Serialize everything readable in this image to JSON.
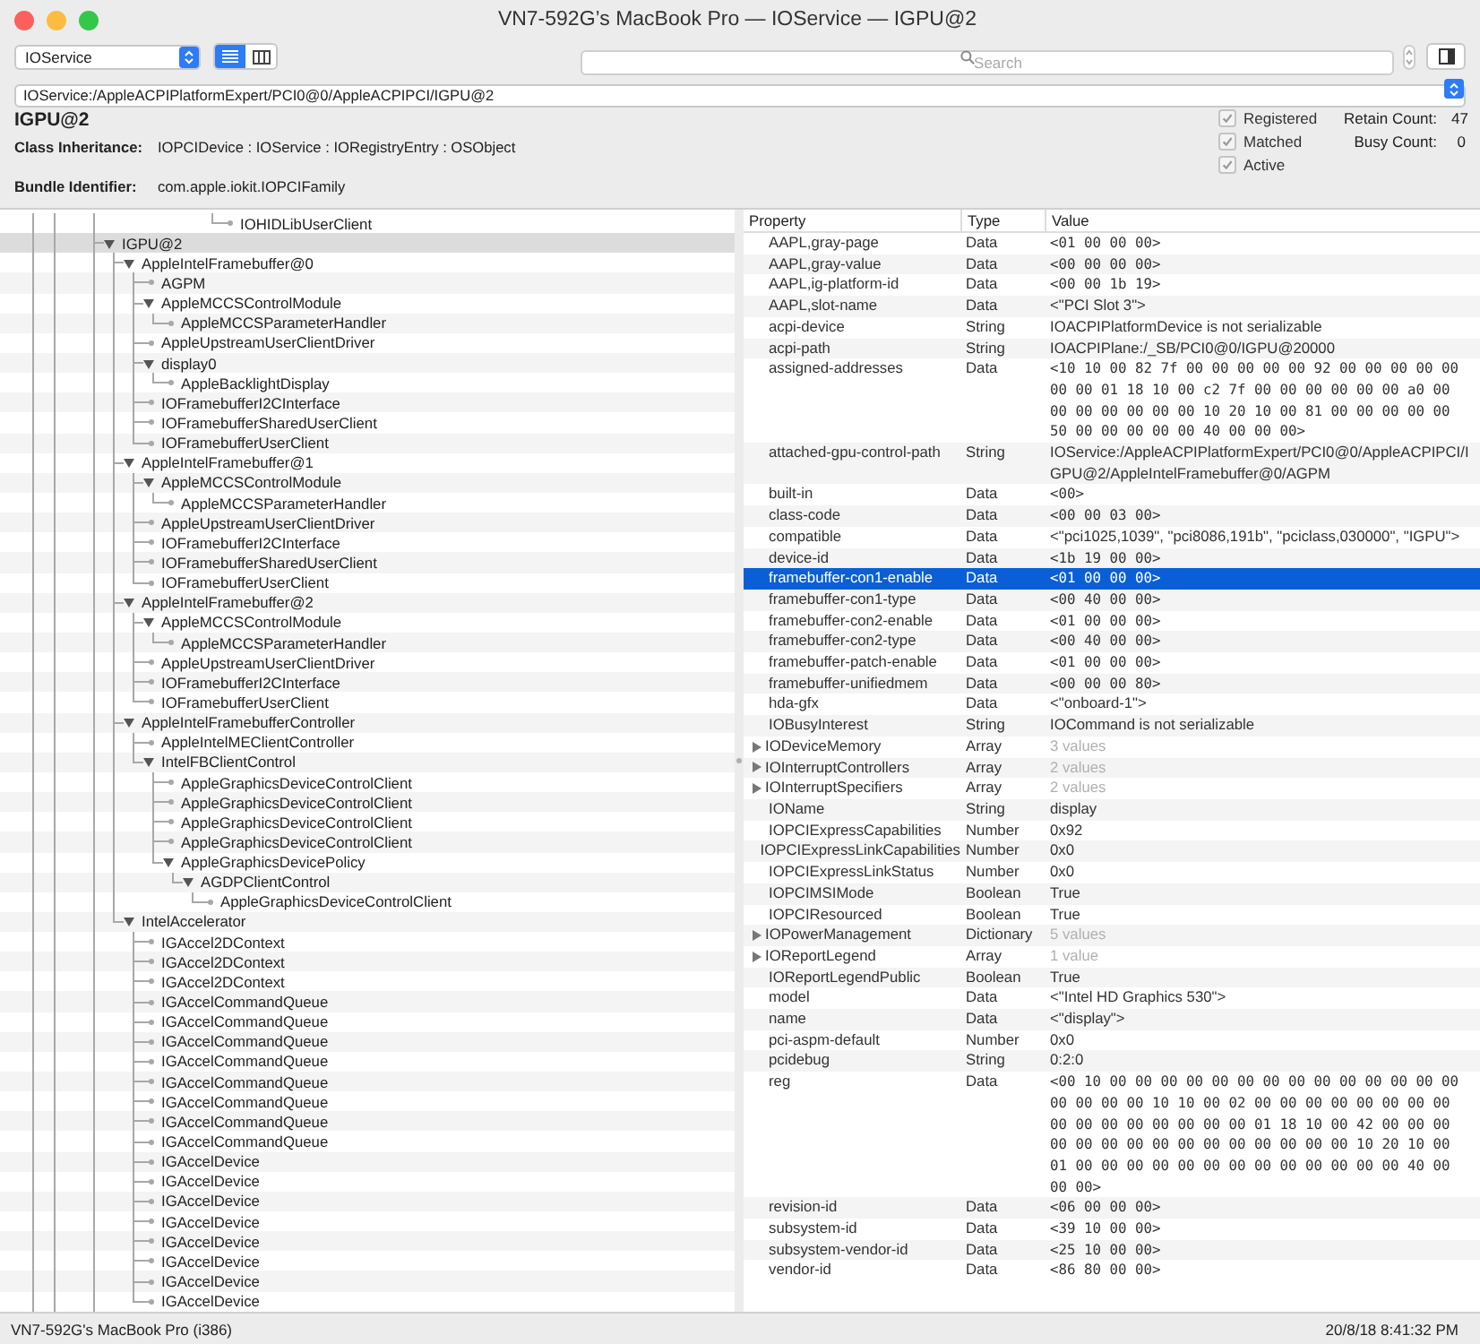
{
  "window": {
    "title": "VN7-592G’s MacBook Pro — IOService — IGPU@2"
  },
  "toolbar": {
    "plane": "IOService",
    "view_modes": [
      {
        "kind": "list",
        "selected": true
      },
      {
        "kind": "columns",
        "selected": false
      }
    ],
    "search": {
      "placeholder": "Search"
    }
  },
  "path": "IOService:/AppleACPIPlatformExpert/PCI0@0/AppleACPIPCI/IGPU@2",
  "info": {
    "name": "IGPU@2",
    "fields": [
      {
        "label": "Class Inheritance:",
        "value": "IOPCIDevice : IOService : IORegistryEntry : OSObject"
      },
      {
        "label": "Bundle Identifier:",
        "value": "com.apple.iokit.IOPCIFamily"
      }
    ],
    "flags": [
      {
        "label": "Registered",
        "checked": true
      },
      {
        "label": "Matched",
        "checked": true
      },
      {
        "label": "Active",
        "checked": true
      }
    ],
    "counts": [
      {
        "label": "Retain Count:",
        "value": "47"
      },
      {
        "label": "Busy Count:",
        "value": "0"
      }
    ]
  },
  "tree": {
    "trailing_row": "IOHIDLibUserClient",
    "nodes": [
      {
        "name": "IGPU@2",
        "selected": true,
        "expanded": true,
        "children": [
          {
            "name": "AppleIntelFramebuffer@0",
            "selected": false,
            "expanded": true,
            "children": [
              {
                "name": "AGPM",
                "selected": false
              },
              {
                "name": "AppleMCCSControlModule",
                "selected": false,
                "expanded": true,
                "children": [
                  {
                    "name": "AppleMCCSParameterHandler",
                    "selected": false
                  }
                ]
              },
              {
                "name": "AppleUpstreamUserClientDriver",
                "selected": false
              },
              {
                "name": "display0",
                "selected": false,
                "expanded": true,
                "children": [
                  {
                    "name": "AppleBacklightDisplay",
                    "selected": false
                  }
                ]
              },
              {
                "name": "IOFramebufferI2CInterface",
                "selected": false
              },
              {
                "name": "IOFramebufferSharedUserClient",
                "selected": false
              },
              {
                "name": "IOFramebufferUserClient",
                "selected": false
              }
            ]
          },
          {
            "name": "AppleIntelFramebuffer@1",
            "selected": false,
            "expanded": true,
            "children": [
              {
                "name": "AppleMCCSControlModule",
                "selected": false,
                "expanded": true,
                "children": [
                  {
                    "name": "AppleMCCSParameterHandler",
                    "selected": false
                  }
                ]
              },
              {
                "name": "AppleUpstreamUserClientDriver",
                "selected": false
              },
              {
                "name": "IOFramebufferI2CInterface",
                "selected": false
              },
              {
                "name": "IOFramebufferSharedUserClient",
                "selected": false
              },
              {
                "name": "IOFramebufferUserClient",
                "selected": false
              }
            ]
          },
          {
            "name": "AppleIntelFramebuffer@2",
            "selected": false,
            "expanded": true,
            "children": [
              {
                "name": "AppleMCCSControlModule",
                "selected": false,
                "expanded": true,
                "children": [
                  {
                    "name": "AppleMCCSParameterHandler",
                    "selected": false
                  }
                ]
              },
              {
                "name": "AppleUpstreamUserClientDriver",
                "selected": false
              },
              {
                "name": "IOFramebufferI2CInterface",
                "selected": false
              },
              {
                "name": "IOFramebufferUserClient",
                "selected": false
              }
            ]
          },
          {
            "name": "AppleIntelFramebufferController",
            "selected": false,
            "expanded": true,
            "children": [
              {
                "name": "AppleIntelMEClientController",
                "selected": false
              },
              {
                "name": "IntelFBClientControl",
                "selected": false,
                "expanded": true,
                "children": [
                  {
                    "name": "AppleGraphicsDeviceControlClient",
                    "selected": false
                  },
                  {
                    "name": "AppleGraphicsDeviceControlClient",
                    "selected": false
                  },
                  {
                    "name": "AppleGraphicsDeviceControlClient",
                    "selected": false
                  },
                  {
                    "name": "AppleGraphicsDeviceControlClient",
                    "selected": false
                  },
                  {
                    "name": "AppleGraphicsDevicePolicy",
                    "selected": false,
                    "expanded": true,
                    "children": [
                      {
                        "name": "AGDPClientControl",
                        "selected": false,
                        "expanded": true,
                        "children": [
                          {
                            "name": "AppleGraphicsDeviceControlClient",
                            "selected": false
                          }
                        ]
                      }
                    ]
                  }
                ]
              }
            ]
          },
          {
            "name": "IntelAccelerator",
            "selected": false,
            "expanded": true,
            "children": [
              {
                "name": "IGAccel2DContext",
                "selected": false
              },
              {
                "name": "IGAccel2DContext",
                "selected": false
              },
              {
                "name": "IGAccel2DContext",
                "selected": false
              },
              {
                "name": "IGAccelCommandQueue",
                "selected": false
              },
              {
                "name": "IGAccelCommandQueue",
                "selected": false
              },
              {
                "name": "IGAccelCommandQueue",
                "selected": false
              },
              {
                "name": "IGAccelCommandQueue",
                "selected": false
              },
              {
                "name": "IGAccelCommandQueue",
                "selected": false
              },
              {
                "name": "IGAccelCommandQueue",
                "selected": false
              },
              {
                "name": "IGAccelCommandQueue",
                "selected": false
              },
              {
                "name": "IGAccelCommandQueue",
                "selected": false
              },
              {
                "name": "IGAccelDevice",
                "selected": false
              },
              {
                "name": "IGAccelDevice",
                "selected": false
              },
              {
                "name": "IGAccelDevice",
                "selected": false
              },
              {
                "name": "IGAccelDevice",
                "selected": false
              },
              {
                "name": "IGAccelDevice",
                "selected": false
              },
              {
                "name": "IGAccelDevice",
                "selected": false
              },
              {
                "name": "IGAccelDevice",
                "selected": false
              },
              {
                "name": "IGAccelDevice",
                "selected": false
              }
            ]
          }
        ]
      }
    ]
  },
  "properties": {
    "columns": [
      "Property",
      "Type",
      "Value"
    ],
    "rows": [
      {
        "property": "AAPL,gray-page",
        "type": "Data",
        "value": "<01 00 00 00>",
        "kind": "hex",
        "selected": false
      },
      {
        "property": "AAPL,gray-value",
        "type": "Data",
        "value": "<00 00 00 00>",
        "kind": "hex",
        "selected": false
      },
      {
        "property": "AAPL,ig-platform-id",
        "type": "Data",
        "value": "<00 00 1b 19>",
        "kind": "hex",
        "selected": false
      },
      {
        "property": "AAPL,slot-name",
        "type": "Data",
        "value": "<\"PCI Slot 3\">",
        "kind": "text",
        "selected": false
      },
      {
        "property": "acpi-device",
        "type": "String",
        "value": "IOACPIPlatformDevice is not serializable",
        "kind": "text",
        "selected": false
      },
      {
        "property": "acpi-path",
        "type": "String",
        "value": "IOACPIPlane:/_SB/PCI0@0/IGPU@20000",
        "kind": "text",
        "selected": false
      },
      {
        "property": "assigned-addresses",
        "type": "Data",
        "value": "<10 10 00 82 7f 00 00 00 00 00 92 00 00 00 00 00 00 00 01 18 10 00 c2 7f 00 00 00 00 00 00 a0 00 00 00 00 00 00 00 10 20 10 00 81 00 00 00 00 00 50 00 00 00 00 00 40 00 00 00>",
        "kind": "hex",
        "selected": false
      },
      {
        "property": "attached-gpu-control-path",
        "type": "String",
        "value": "IOService:/AppleACPIPlatformExpert/PCI0@0/AppleACPIPCI/IGPU@2/AppleIntelFramebuffer@0/AGPM",
        "kind": "path",
        "selected": false
      },
      {
        "property": "built-in",
        "type": "Data",
        "value": "<00>",
        "kind": "hex",
        "selected": false
      },
      {
        "property": "class-code",
        "type": "Data",
        "value": "<00 00 03 00>",
        "kind": "hex",
        "selected": false
      },
      {
        "property": "compatible",
        "type": "Data",
        "value": "<\"pci1025,1039\", \"pci8086,191b\", \"pciclass,030000\", \"IGPU\">",
        "kind": "text",
        "selected": false
      },
      {
        "property": "device-id",
        "type": "Data",
        "value": "<1b 19 00 00>",
        "kind": "hex",
        "selected": false
      },
      {
        "property": "framebuffer-con1-enable",
        "type": "Data",
        "value": "<01 00 00 00>",
        "kind": "hex",
        "selected": true
      },
      {
        "property": "framebuffer-con1-type",
        "type": "Data",
        "value": "<00 40 00 00>",
        "kind": "hex",
        "selected": false
      },
      {
        "property": "framebuffer-con2-enable",
        "type": "Data",
        "value": "<01 00 00 00>",
        "kind": "hex",
        "selected": false
      },
      {
        "property": "framebuffer-con2-type",
        "type": "Data",
        "value": "<00 40 00 00>",
        "kind": "hex",
        "selected": false
      },
      {
        "property": "framebuffer-patch-enable",
        "type": "Data",
        "value": "<01 00 00 00>",
        "kind": "hex",
        "selected": false
      },
      {
        "property": "framebuffer-unifiedmem",
        "type": "Data",
        "value": "<00 00 00 80>",
        "kind": "hex",
        "selected": false
      },
      {
        "property": "hda-gfx",
        "type": "Data",
        "value": "<\"onboard-1\">",
        "kind": "text",
        "selected": false
      },
      {
        "property": "IOBusyInterest",
        "type": "String",
        "value": "IOCommand is not serializable",
        "kind": "text",
        "selected": false
      },
      {
        "property": "IODeviceMemory",
        "type": "Array",
        "value": "3 values",
        "kind": "count",
        "selected": false,
        "expanded": false
      },
      {
        "property": "IOInterruptControllers",
        "type": "Array",
        "value": "2 values",
        "kind": "count",
        "selected": false,
        "expanded": false
      },
      {
        "property": "IOInterruptSpecifiers",
        "type": "Array",
        "value": "2 values",
        "kind": "count",
        "selected": false,
        "expanded": false
      },
      {
        "property": "IOName",
        "type": "String",
        "value": "display",
        "kind": "text",
        "selected": false
      },
      {
        "property": "IOPCIExpressCapabilities",
        "type": "Number",
        "value": "0x92",
        "kind": "text",
        "selected": false
      },
      {
        "property": "IOPCIExpressLinkCapabilities",
        "type": "Number",
        "value": "0x0",
        "kind": "text",
        "selected": false
      },
      {
        "property": "IOPCIExpressLinkStatus",
        "type": "Number",
        "value": "0x0",
        "kind": "text",
        "selected": false
      },
      {
        "property": "IOPCIMSIMode",
        "type": "Boolean",
        "value": "True",
        "kind": "text",
        "selected": false
      },
      {
        "property": "IOPCIResourced",
        "type": "Boolean",
        "value": "True",
        "kind": "text",
        "selected": false
      },
      {
        "property": "IOPowerManagement",
        "type": "Dictionary",
        "value": "5 values",
        "kind": "count",
        "selected": false,
        "expanded": false
      },
      {
        "property": "IOReportLegend",
        "type": "Array",
        "value": "1 value",
        "kind": "count",
        "selected": false,
        "expanded": false
      },
      {
        "property": "IOReportLegendPublic",
        "type": "Boolean",
        "value": "True",
        "kind": "text",
        "selected": false
      },
      {
        "property": "model",
        "type": "Data",
        "value": "<\"Intel HD Graphics 530\">",
        "kind": "text",
        "selected": false
      },
      {
        "property": "name",
        "type": "Data",
        "value": "<\"display\">",
        "kind": "text",
        "selected": false
      },
      {
        "property": "pci-aspm-default",
        "type": "Number",
        "value": "0x0",
        "kind": "text",
        "selected": false
      },
      {
        "property": "pcidebug",
        "type": "String",
        "value": "0:2:0",
        "kind": "text",
        "selected": false
      },
      {
        "property": "reg",
        "type": "Data",
        "value": "<00 10 00 00 00 00 00 00 00 00 00 00 00 00 00 00 00 00 00 00 10 10 00 02 00 00 00 00 00 00 00 00 00 00 00 00 00 00 00 00 01 18 10 00 42 00 00 00 00 00 00 00 00 00 00 00 00 00 00 00 10 20 10 00 01 00 00 00 00 00 00 00 00 00 00 00 00 00 40 00 00 00>",
        "kind": "hex",
        "selected": false
      },
      {
        "property": "revision-id",
        "type": "Data",
        "value": "<06 00 00 00>",
        "kind": "hex",
        "selected": false
      },
      {
        "property": "subsystem-id",
        "type": "Data",
        "value": "<39 10 00 00>",
        "kind": "hex",
        "selected": false
      },
      {
        "property": "subsystem-vendor-id",
        "type": "Data",
        "value": "<25 10 00 00>",
        "kind": "hex",
        "selected": false
      },
      {
        "property": "vendor-id",
        "type": "Data",
        "value": "<86 80 00 00>",
        "kind": "hex",
        "selected": false
      }
    ]
  },
  "status_bar": {
    "machine": "VN7-592G's MacBook Pro (i386)",
    "time": "20/8/18 8:41:32 PM"
  }
}
